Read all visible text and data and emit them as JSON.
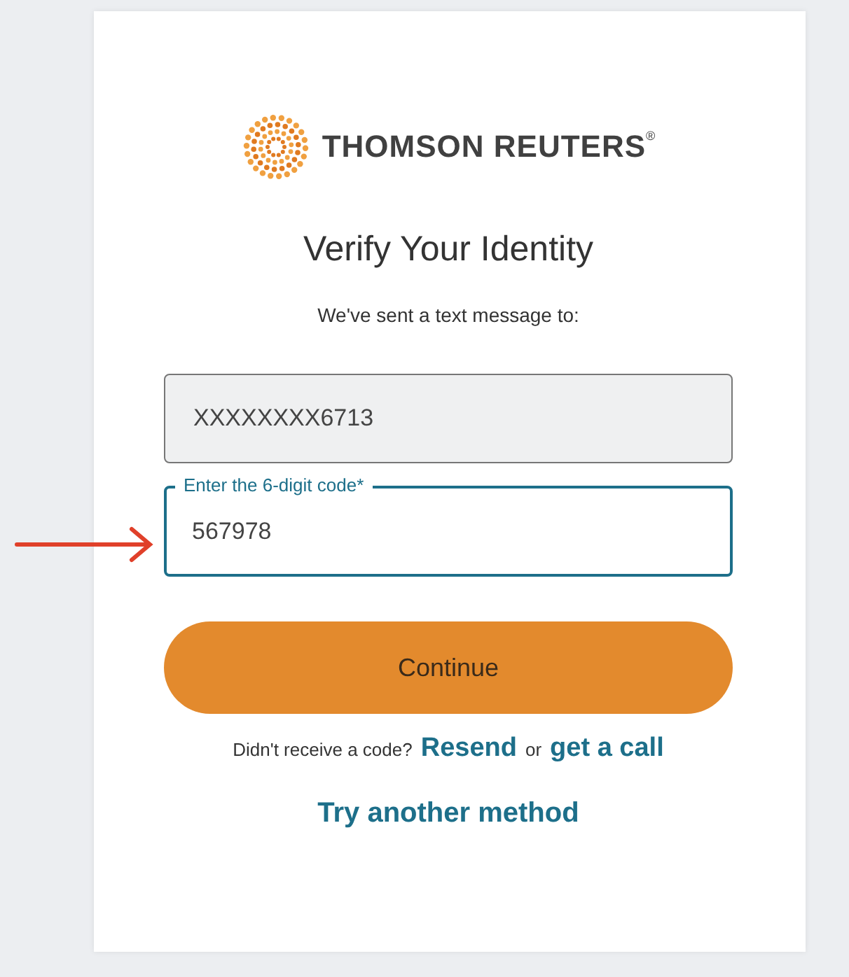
{
  "logo": {
    "text": "THOMSON REUTERS$^{®}$"
  },
  "heading": "Verify Your Identity",
  "subtitle": "We've sent a text message to:",
  "phone_field": {
    "value": "XXXXXXXX6713",
    "disabled": true
  },
  "code_field": {
    "label": "Enter the 6-digit code*",
    "value": "567978",
    "focused": true
  },
  "continue_button": {
    "label": "Continue"
  },
  "resend": {
    "prompt": "Didn't receive a code?",
    "resend_link": "Resend",
    "separator": "or",
    "call_link": "get a call"
  },
  "alternative_link": "Try another method",
  "annotation": {
    "kind": "arrow"
  }
}
